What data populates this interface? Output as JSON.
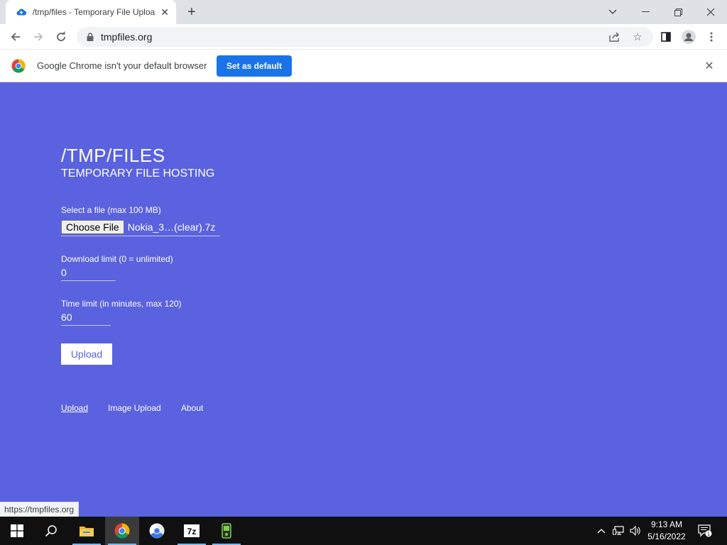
{
  "browser": {
    "tab_title": "/tmp/files - Temporary File Uploa",
    "url": "tmpfiles.org",
    "window_controls": [
      "minimize",
      "restore",
      "close"
    ]
  },
  "infobar": {
    "message": "Google Chrome isn't your default browser",
    "button_label": "Set as default"
  },
  "page": {
    "title": "/TMP/FILES",
    "subtitle": "TEMPORARY FILE HOSTING",
    "file_label": "Select a file (max 100 MB)",
    "choose_file_label": "Choose File",
    "file_name": "Nokia_3…(clear).7z",
    "download_limit_label": "Download limit (0 = unlimited)",
    "download_limit_value": "0",
    "time_limit_label": "Time limit (in minutes, max 120)",
    "time_limit_value": "60",
    "upload_button": "Upload",
    "nav": [
      {
        "label": "Upload",
        "active": true
      },
      {
        "label": "Image Upload",
        "active": false
      },
      {
        "label": "About",
        "active": false
      }
    ]
  },
  "status_bar": "https://tmpfiles.org",
  "taskbar": {
    "time": "9:13 AM",
    "date": "5/16/2022",
    "notification_count": "1",
    "apps": [
      "file-explorer",
      "chrome",
      "chrome-alt",
      "7zip",
      "phone-tool"
    ]
  },
  "colors": {
    "page_bg": "#5a62df",
    "accent": "#1a73e8",
    "taskbar_bg": "#101010"
  }
}
